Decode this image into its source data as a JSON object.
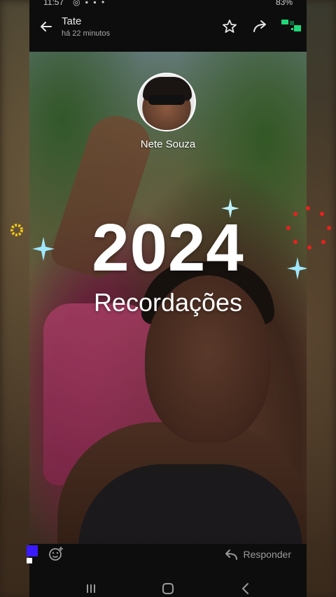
{
  "status": {
    "time": "11:57",
    "icons": "◎ ▪ ▪ •",
    "battery": "83%"
  },
  "header": {
    "title": "Tate",
    "subtitle": "há 22 minutos"
  },
  "story": {
    "author_name": "Nete Souza",
    "year_text": "2024",
    "caption_text": "Recordações"
  },
  "reply": {
    "label": "Responder"
  },
  "icons": {
    "back": "arrow-left-icon",
    "star": "star-icon",
    "forward": "forward-icon",
    "emoji": "emoji-add-icon",
    "reply": "reply-arrow-icon"
  },
  "colors": {
    "accent_green": "#1fd67a",
    "sparkle_blue": "#9fe8ff",
    "overlay_blue": "#3a1aff",
    "dots_red": "#e5221e",
    "ring_yellow": "#f0c419"
  }
}
